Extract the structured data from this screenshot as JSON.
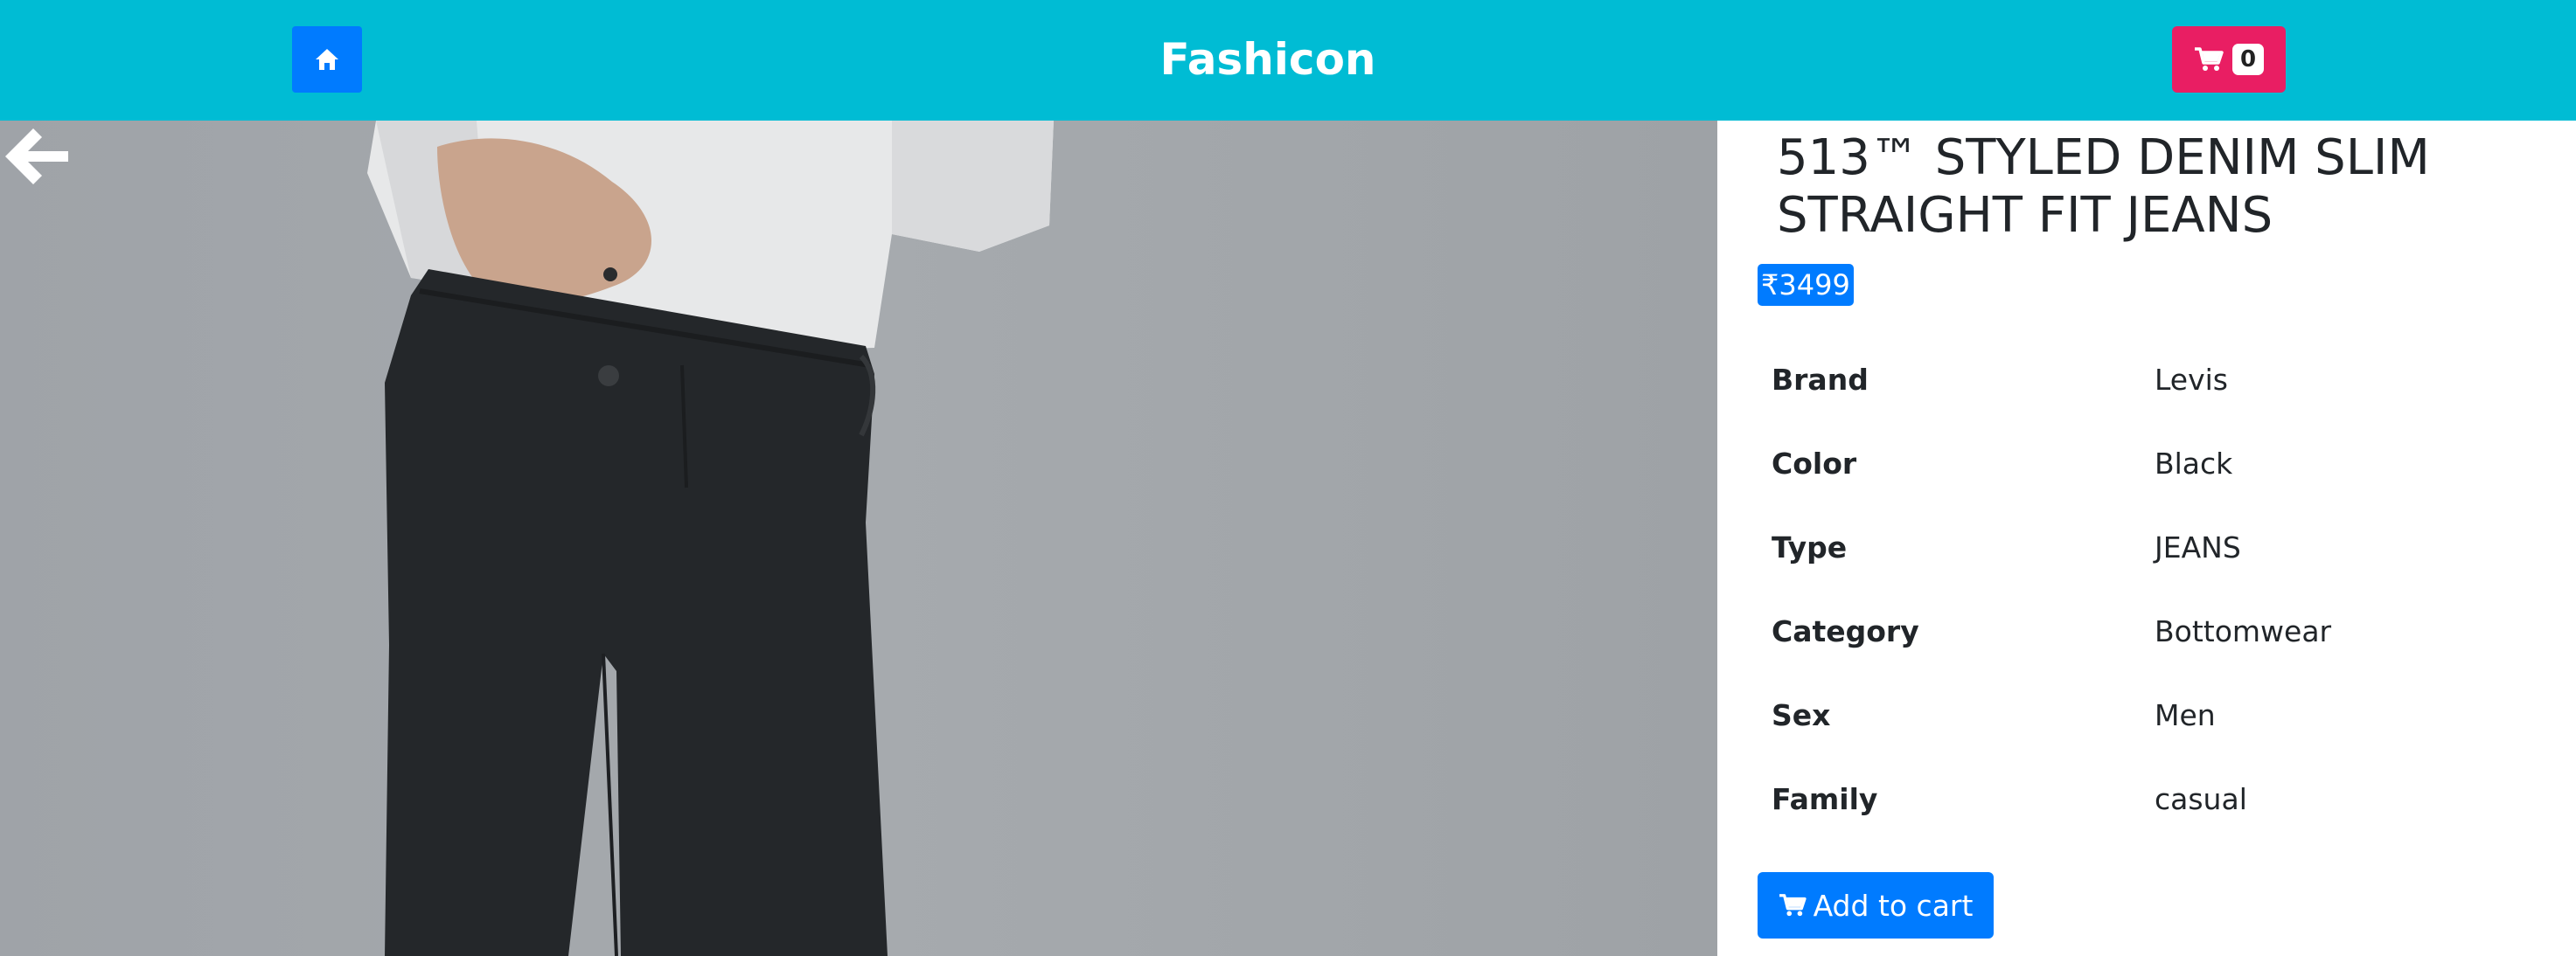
{
  "navbar": {
    "brand": "Fashicon",
    "home_icon": "home-icon",
    "cart_icon": "shopping-cart-icon",
    "cart_count": "0",
    "bg_color": "#00BCD4",
    "home_btn_color": "#007BFF",
    "cart_btn_color": "#E91E63"
  },
  "product": {
    "title": "513™ STYLED DENIM SLIM STRAIGHT FIT JEANS",
    "price": "₹3499",
    "back_icon": "arrow-left-icon",
    "attributes": [
      {
        "label": "Brand",
        "value": "Levis"
      },
      {
        "label": "Color",
        "value": "Black"
      },
      {
        "label": "Type",
        "value": "JEANS"
      },
      {
        "label": "Category",
        "value": "Bottomwear"
      },
      {
        "label": "Sex",
        "value": "Men"
      },
      {
        "label": "Family",
        "value": "casual"
      }
    ],
    "add_to_cart_label": "Add to cart",
    "accent_color": "#007BFF"
  }
}
